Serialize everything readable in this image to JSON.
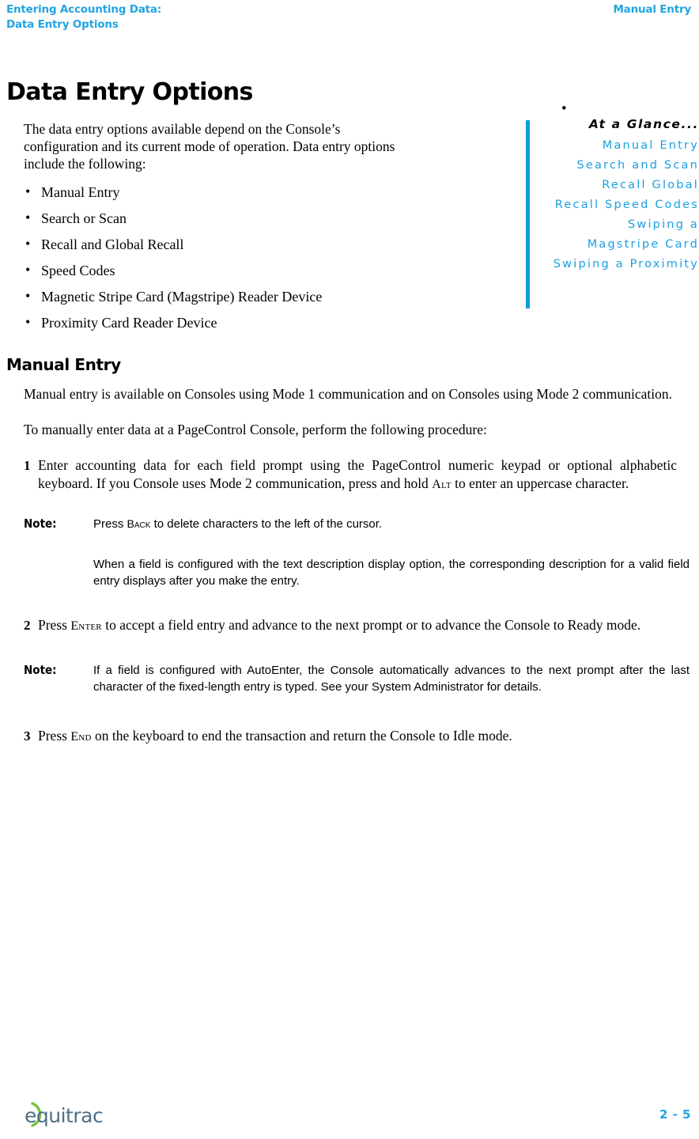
{
  "header": {
    "left_line1": "Entering Accounting Data:",
    "left_line2": "Data Entry Options",
    "right": "Manual Entry",
    "color": "#21A4E0"
  },
  "main": {
    "chapter_title": "Data Entry Options",
    "intro": "The data entry options available depend on the Console’s configuration and its current mode of operation. Data entry options include the following:",
    "options": [
      "Manual Entry",
      "Search or Scan",
      "Recall and Global Recall",
      "Speed Codes",
      "Magnetic Stripe Card (Magstripe) Reader Device",
      "Proximity Card Reader Device"
    ],
    "section_title": "Manual Entry",
    "para1": "Manual entry is available on Consoles using Mode 1 communication and on Consoles using Mode 2 communication.",
    "para2": "To manually enter data at a PageControl Console, perform the following procedure:",
    "steps": [
      {
        "num": "1",
        "text_a": "Enter accounting data for each field prompt using the PageControl numeric keypad or optional alphabetic keyboard. If you Console uses Mode 2 communication, press and hold ",
        "key": "Alt",
        "text_b": " to enter an uppercase character."
      },
      {
        "num": "2",
        "text_a": "Press ",
        "key": "Enter",
        "text_b": " to accept a field entry and advance to the next prompt or to advance the Console to Ready mode."
      },
      {
        "num": "3",
        "text_a": "Press ",
        "key": "End",
        "text_b": " on the keyboard to end the transaction and return the Console to Idle mode."
      }
    ],
    "note1": {
      "label": "Note:",
      "body_a": "Press ",
      "key": "Back",
      "body_b": " to delete characters to the left of the cursor.",
      "body2": "When a field is configured with the text description display option, the corresponding description for a valid field entry displays after you make the entry."
    },
    "note2": {
      "label": "Note:",
      "body": "If a field is configured with AutoEnter, the Console automatically advances to the next prompt after the last character of the fixed-length entry is typed. See your System Administrator for details."
    }
  },
  "glance": {
    "bullet": "•",
    "title": "At a Glance...",
    "bar_color": "#119BD8",
    "item_color": "#1B9FE0",
    "items": [
      "Manual Entry",
      "Search and Scan",
      "Recall Global",
      "Recall Speed Codes",
      "Swiping a",
      "Magstripe Card",
      "Swiping a Proximity"
    ]
  },
  "footer": {
    "logo_text": "equitrac",
    "page_number": "2 - 5",
    "page_number_color": "#21A4E0"
  }
}
